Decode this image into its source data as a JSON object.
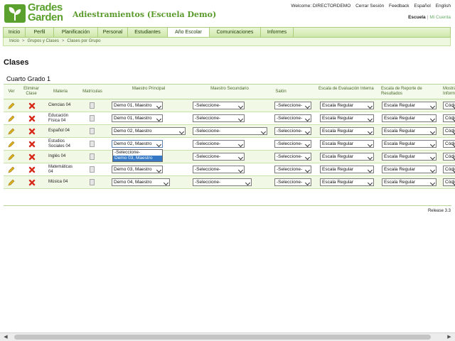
{
  "brand": {
    "name_line1": "Grades",
    "name_line2": "Garden",
    "title": "Adiestramientos (Escuela Demo)",
    "accent": "#5aa02c"
  },
  "top_links": [
    "Welcome: DIRECTORDEMO",
    "Cerrar Sesión",
    "Feedback",
    "Español",
    "English"
  ],
  "school_links": {
    "current": "Escuela",
    "other": "Mi Cuenta"
  },
  "nav": [
    "Inicio",
    "Perfil",
    "Planificación",
    "Personal",
    "Estudiantes",
    "Año Escolar",
    "Comunicaciones",
    "Informes"
  ],
  "nav_active": "Año Escolar",
  "breadcrumbs": [
    "Inicio",
    "Grupos y Clases",
    "Clases por Grupo"
  ],
  "page_title": "Clases",
  "grade_title": "Cuarto Grado 1",
  "columns": [
    "Ver",
    "Eliminar Clase",
    "Materia",
    "Matrículas",
    "Maestro Principal",
    "Maestro Secundario",
    "Salón",
    "Escala de Evaluación Interna",
    "Escala de Reporte de Resultados",
    "Mostrar en Informe"
  ],
  "rows": [
    {
      "materia": "Ciencias 04",
      "maestro_principal": "Demo 01, Maestro",
      "maestro_secundario": "-Seleccione-",
      "salon": "-Seleccione-",
      "escala_interna": "Escala Regular",
      "escala_reporte": "Escala Regular",
      "mostrar": "Código"
    },
    {
      "materia": "Educación Física 04",
      "maestro_principal": "Demo 01, Maestro",
      "maestro_secundario": "-Seleccione-",
      "salon": "-Seleccione-",
      "escala_interna": "Escala Regular",
      "escala_reporte": "Escala Regular",
      "mostrar": "Código"
    },
    {
      "materia": "Español 04",
      "maestro_principal": "Demo 02, Maestro",
      "maestro_secundario": "-Seleccione-",
      "salon": "-Seleccione-",
      "escala_interna": "Escala Regular",
      "escala_reporte": "Escala Regular",
      "mostrar": "Código"
    },
    {
      "materia": "Estudios Sociales 04",
      "maestro_principal": "Demo 02, Maestro",
      "maestro_secundario": "-Seleccione-",
      "salon": "-Seleccione-",
      "escala_interna": "Escala Regular",
      "escala_reporte": "Escala Regular",
      "mostrar": "Código"
    },
    {
      "materia": "Inglés 04",
      "maestro_principal": "",
      "maestro_secundario": "-Seleccione-",
      "salon": "-Seleccione-",
      "escala_interna": "Escala Regular",
      "escala_reporte": "Escala Regular",
      "mostrar": "Código"
    },
    {
      "materia": "Matemáticas 04",
      "maestro_principal": "Demo 03, Maestro",
      "maestro_secundario": "-Seleccione-",
      "salon": "-Seleccione-",
      "escala_interna": "Escala Regular",
      "escala_reporte": "Escala Regular",
      "mostrar": "Código"
    },
    {
      "materia": "Música 04",
      "maestro_principal": "Demo 04, Maestro",
      "maestro_secundario": "-Seleccione-",
      "salon": "-Seleccione-",
      "escala_interna": "Escala Regular",
      "escala_reporte": "Escala Regular",
      "mostrar": "Código"
    }
  ],
  "dropdown_options": [
    "-Seleccione-",
    "Demo 03, Maestro"
  ],
  "dropdown_highlight": "Demo 03, Maestro",
  "release": "Release 3.3",
  "icons": {
    "view": "pencil-icon",
    "delete": "x-icon",
    "enrollments": "document-icon"
  }
}
